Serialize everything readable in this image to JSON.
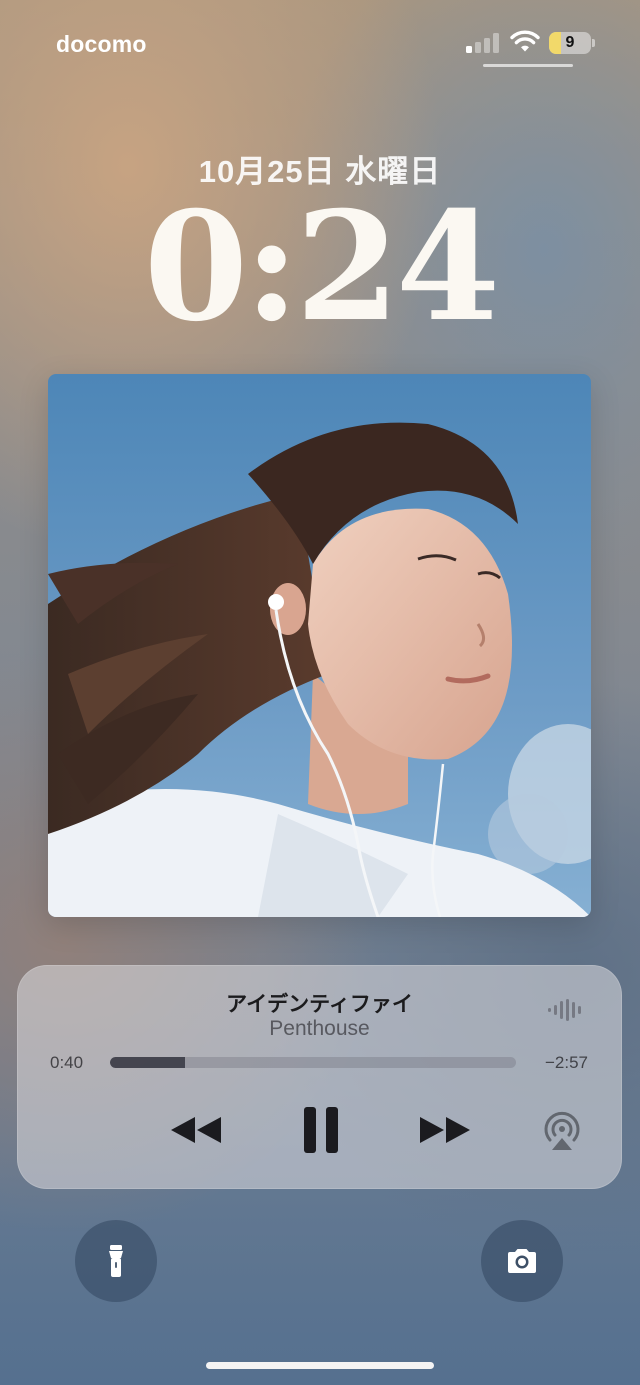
{
  "status_bar": {
    "carrier": "docomo",
    "signal_bars_active": 1,
    "signal_bars_total": 4,
    "wifi_icon": "wifi-icon",
    "battery_level": 9,
    "battery_text": "9",
    "battery_color": "#f2d96a"
  },
  "lock_screen": {
    "date": "10月25日 水曜日",
    "time": "0:24"
  },
  "now_playing": {
    "artwork_icon": "album-artwork",
    "title": "アイデンティファイ",
    "artist": "Penthouse",
    "elapsed": "0:40",
    "remaining": "−2:57",
    "progress_fraction": 0.184,
    "controls": {
      "rewind": "rewind-icon",
      "pause": "pause-icon",
      "forward": "fast-forward-icon",
      "airplay": "airplay-audio-icon",
      "waveform": "waveform-icon"
    }
  },
  "shortcuts": {
    "left": "flashlight-icon",
    "right": "camera-icon"
  }
}
